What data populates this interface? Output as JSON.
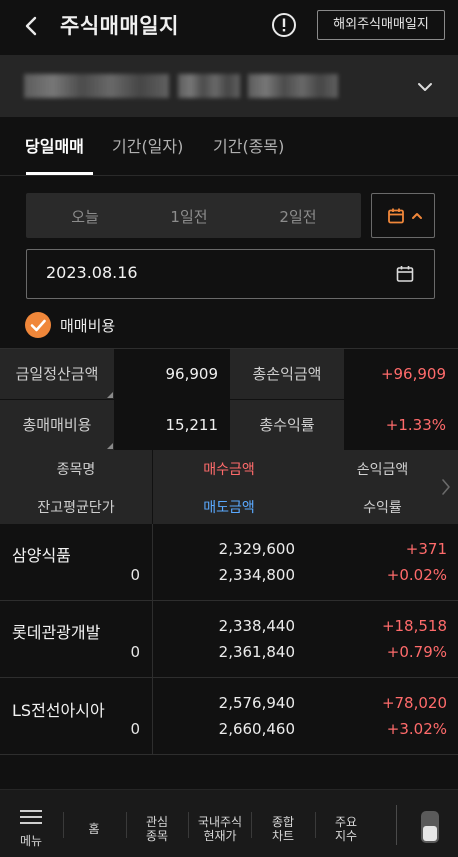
{
  "header": {
    "title": "주식매매일지",
    "overseas_button": "해외주식매매일지"
  },
  "tabs": [
    {
      "label": "당일매매",
      "active": true
    },
    {
      "label": "기간(일자)",
      "active": false
    },
    {
      "label": "기간(종목)",
      "active": false
    }
  ],
  "period_segment": [
    "오늘",
    "1일전",
    "2일전"
  ],
  "date_value": "2023.08.16",
  "fee_checkbox": {
    "label": "매매비용",
    "checked": true
  },
  "summary": {
    "settle_label": "금일정산금액",
    "settle_value": "96,909",
    "pnl_label": "총손익금액",
    "pnl_value": "+96,909",
    "cost_label": "총매매비용",
    "cost_value": "15,211",
    "return_label": "총수익률",
    "return_value": "+1.33%"
  },
  "list_header": {
    "name": "종목명",
    "buy_amount": "매수금액",
    "pnl_amount": "손익금액",
    "avg_price": "잔고평균단가",
    "sell_amount": "매도금액",
    "return_rate": "수익률"
  },
  "rows": [
    {
      "name": "삼양식품",
      "qty": "0",
      "buy": "2,329,600",
      "sell": "2,334,800",
      "pnl": "+371",
      "rate": "+0.02%"
    },
    {
      "name": "롯데관광개발",
      "qty": "0",
      "buy": "2,338,440",
      "sell": "2,361,840",
      "pnl": "+18,518",
      "rate": "+0.79%"
    },
    {
      "name": "LS전선아시아",
      "qty": "0",
      "buy": "2,576,940",
      "sell": "2,660,460",
      "pnl": "+78,020",
      "rate": "+3.02%"
    }
  ],
  "bottom_nav": {
    "menu": "메뉴",
    "home": "홈",
    "watch_1": "관심",
    "watch_2": "종목",
    "domestic_1": "국내주식",
    "domestic_2": "현재가",
    "chart_1": "종합",
    "chart_2": "차트",
    "index_1": "주요",
    "index_2": "지수"
  },
  "colors": {
    "background": "#111111",
    "panel": "#262626",
    "positive": "#ff6b6b",
    "sell": "#5aa9ff",
    "accent": "#f0873a"
  }
}
